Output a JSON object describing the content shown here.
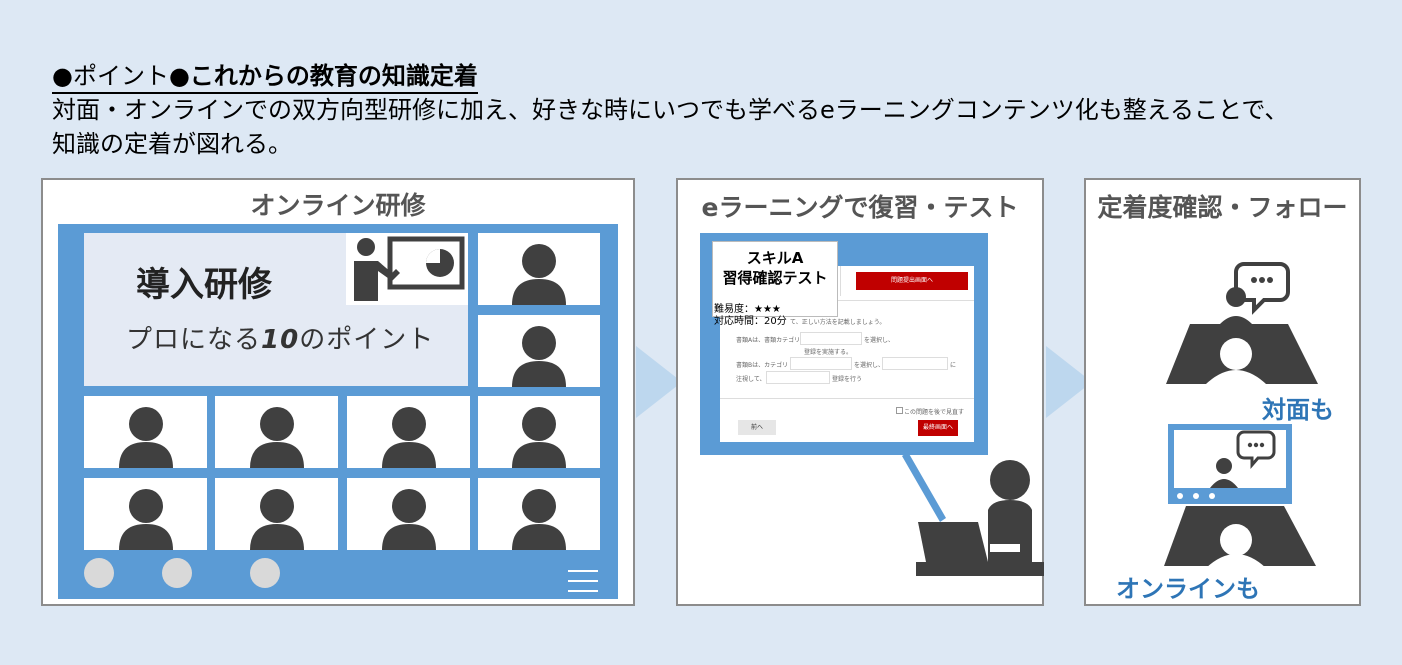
{
  "header": {
    "point_prefix": "●ポイント●",
    "point_title": "これからの教育の知識定着",
    "description_line1": "対面・オンラインでの双方向型研修に加え、好きな時にいつでも学べるeラーニングコンテンツ化も整えることで、",
    "description_line2": "知識の定着が図れる。"
  },
  "online_panel": {
    "title": "オンライン研修",
    "slide_title": "導入研修",
    "slide_subtitle_prefix": "プロになる",
    "slide_subtitle_number": "10",
    "slide_subtitle_suffix": "のポイント",
    "icons": [
      "presenter-icon",
      "person-icon",
      "hamburger-icon"
    ]
  },
  "elearning_panel": {
    "title": "eラーニングで復習・テスト",
    "quiz_title_line1": "スキルA",
    "quiz_title_line2": "習得確認テスト",
    "difficulty": "難易度：★★★",
    "time": "対応時間：20分",
    "top_button": "問題提出画面へ",
    "instruction": "て、正しい方法を記載しましょう。",
    "row1a": "書類Aは、書類カテゴリ",
    "row1b": "を選択し、",
    "row1c": "登録を実施する。",
    "row2a": "書類Bは、カテゴリ",
    "row2b": "を選択し、",
    "row2c": "に",
    "row3a": "注視して、",
    "row3b": "登録を行う",
    "checkbox_label": "この問題を後で見直す",
    "prev_button": "前へ",
    "final_button": "最終画面へ"
  },
  "follow_panel": {
    "title": "定着度確認・フォロー",
    "face_to_face_label": "対面も",
    "online_label": "オンラインも",
    "colors": {
      "accent_blue": "#2e75b6",
      "screen_blue": "#5b9bd5",
      "arrow": "#bdd7ee",
      "figure": "#404040"
    }
  }
}
